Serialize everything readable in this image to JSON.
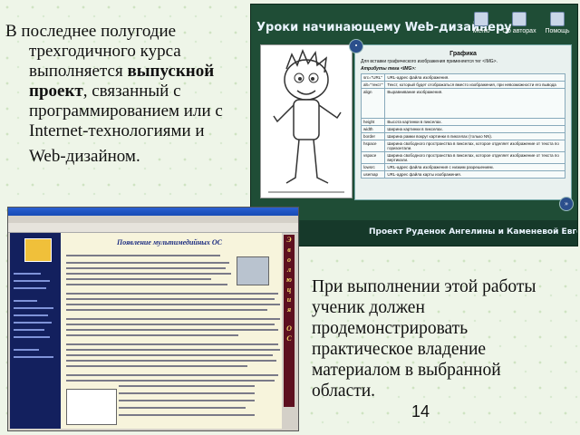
{
  "text_block_1": [
    "В последнее полугодие",
    "трехгодичного курса",
    "выполняется ",
    "выпускной",
    "проект",
    ", связанный с",
    "программированием или с",
    "Internet-технологиями и",
    "Web-дизайном."
  ],
  "text_block_2": [
    "При выполнении этой работы",
    "ученик должен",
    "продемонстрировать",
    "практическое владение",
    "материалом в выбранной",
    "области."
  ],
  "page_number": "14",
  "screenshot1": {
    "title": "Уроки начинающему Web-дизайнеру",
    "menu": [
      "Меню",
      "Об авторах",
      "Помощь"
    ],
    "panel_heading": "Графика",
    "panel_intro": "Для вставки графического изображения применяется тег <IMG>.",
    "panel_sub": "Атрибуты тега <IMG>:",
    "table": [
      [
        "src=\"URL\"",
        "URL-адрес файла изображения."
      ],
      [
        "alt=\"текст\"",
        "Текст, который будет отображаться вместо изображения, при невозможности его вывода"
      ],
      [
        "align",
        "Выравнивание изображения."
      ],
      [
        "height",
        "Высота картинки в пикселах."
      ],
      [
        "width",
        "Ширина картинки в пикселах."
      ],
      [
        "border",
        "Ширина рамки вокруг картинки в пикселах (только NN)."
      ],
      [
        "hspace",
        "Ширина свободного пространства в пикселах, которое отделяет изображение от текста по горизонтали."
      ],
      [
        "vspace",
        "Ширина свободного пространства в пикселах, которое отделяет изображение от текста по вертикали."
      ],
      [
        "lowsrc",
        "URL-адрес файла изображения с низким разрешением."
      ],
      [
        "usemap",
        "URL-адрес файла карты изображения."
      ]
    ],
    "footer": "Проект Руденок Ангелины и Каменевой Евгении"
  },
  "screenshot2": {
    "heading": "Появление мультимедийных ОС",
    "side_title": [
      "Э",
      "в",
      "о",
      "л",
      "ю",
      "ц",
      "и",
      "я",
      "",
      "О",
      "С"
    ]
  }
}
